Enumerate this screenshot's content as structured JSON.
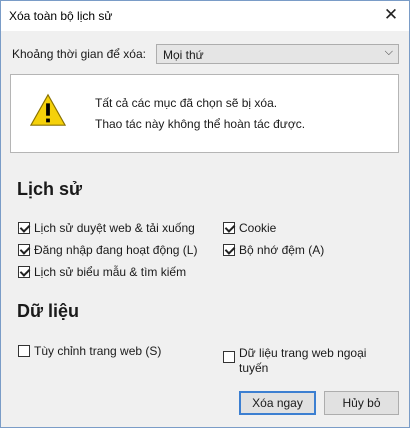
{
  "window": {
    "title": "Xóa toàn bộ lịch sử"
  },
  "time_range": {
    "label": "Khoảng thời gian để xóa:",
    "selected": "Mọi thứ"
  },
  "warning": {
    "line1": "Tất cả các mục đã chọn sẽ bị xóa.",
    "line2": "Thao tác này không thể hoàn tác được."
  },
  "history": {
    "title": "Lịch sử",
    "items": [
      {
        "label": "Lịch sử duyệt web & tải xuống",
        "checked": true
      },
      {
        "label": "Cookie",
        "checked": true
      },
      {
        "label": "Đăng nhập đang hoạt động (L)",
        "checked": true
      },
      {
        "label": "Bộ nhớ đệm (A)",
        "checked": true
      },
      {
        "label": "Lịch sử biểu mẫu & tìm kiếm",
        "checked": true
      }
    ]
  },
  "data_section": {
    "title": "Dữ liệu",
    "items": [
      {
        "label": "Tùy chỉnh trang web (S)",
        "checked": false
      },
      {
        "label_line1": "Dữ liệu trang web ngoại",
        "label_line2": "tuyến",
        "checked": false
      }
    ]
  },
  "buttons": {
    "clear_now": "Xóa ngay",
    "cancel": "Hủy bỏ"
  }
}
